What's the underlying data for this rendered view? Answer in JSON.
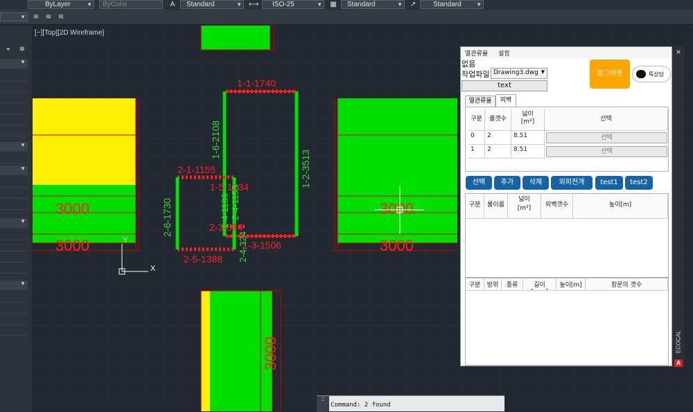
{
  "ribbon": {
    "layer_linetype": "ByLayer",
    "color": "ByColor",
    "text_style": "Standard",
    "dim_style": "ISO-25",
    "table_style": "Standard",
    "multileader_style": "Standard"
  },
  "viewport_label": "[−][Top][2D Wireframe]",
  "drawing": {
    "labels": {
      "room1_top": "1-1-1740",
      "room1_left": "1-6-2108",
      "room1_right": "1-2-3513",
      "room1_bottom": "1-3-1506",
      "room2_top": "2-1-1155",
      "room2_left": "2-6-1730",
      "room2_bottom": "2-5-1388",
      "overlap1": "1-5-1234",
      "overlap2": "2-3-324",
      "overlap3": "1-4-1189",
      "overlap4": "2-4-324",
      "overlap5": "2-4-1155",
      "dim_left_a": "3000",
      "dim_left_b": "3000",
      "dim_right_a": "3000",
      "dim_right_b": "3000",
      "dim_vertical": "3000"
    },
    "ucs": {
      "x": "X",
      "y": "Y"
    },
    "colors": {
      "green": "#00e000",
      "yellow": "#fff000",
      "red": "#ff2020",
      "green_text": "#33dd33"
    }
  },
  "panel": {
    "menu": [
      "열관류율",
      "설정"
    ],
    "status": "없음",
    "workfile_label": "작업파일",
    "workfile_value": "Drawing3.dwg",
    "text_button": "text",
    "logout_button": "로그아웃",
    "chat_button": "특상담",
    "tabs": [
      "열관류율",
      "외벽"
    ],
    "table1": {
      "headers": [
        "구분",
        "룸갯수",
        "넓이\n[m²]",
        "선택"
      ],
      "rows": [
        {
          "id": "0",
          "rooms": "2",
          "area": "8.51",
          "select": "선택"
        },
        {
          "id": "1",
          "rooms": "2",
          "area": "8.51",
          "select": "선택"
        }
      ]
    },
    "actions": [
      "선택",
      "추가",
      "삭제",
      "외피전개",
      "test1",
      "test2"
    ],
    "table2_headers": [
      "구분",
      "룸이름",
      "넓이\n[m²]",
      "외벽갯수",
      "높이[m]"
    ],
    "table3_headers": [
      "구분",
      "방위",
      "종류",
      "길이[mm]",
      "높이[m]",
      "창문의 갯수"
    ],
    "side_label": "ECOCAL",
    "logo_letter": "A",
    "accent": "#1565a6",
    "logout_color": "#ffa500"
  },
  "command": {
    "text": "Command: 2 found"
  }
}
